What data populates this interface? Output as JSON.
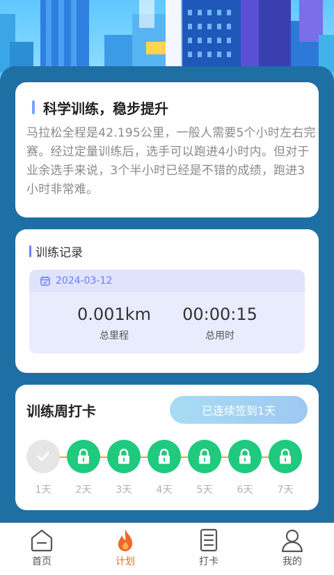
{
  "intro": {
    "title": "科学训练，稳步提升",
    "body": "马拉松全程是42.195公里，一般人需要5个小时左右完赛。经过定量训练后，选手可以跑进4小时内。但对于业余选手来说，3个半小时已经是不错的成绩，跑进3小时非常难。"
  },
  "record": {
    "title": "训练记录",
    "date": "2024-03-12",
    "distance": "0.001km",
    "distance_label": "总里程",
    "duration": "00:00:15",
    "duration_label": "总用时"
  },
  "checkin": {
    "title": "训练周打卡",
    "status": "已连续签到1天",
    "days": [
      {
        "label": "1天",
        "state": "done"
      },
      {
        "label": "2天",
        "state": "locked"
      },
      {
        "label": "3天",
        "state": "locked"
      },
      {
        "label": "4天",
        "state": "locked"
      },
      {
        "label": "5天",
        "state": "locked"
      },
      {
        "label": "6天",
        "state": "locked"
      },
      {
        "label": "7天",
        "state": "locked"
      }
    ]
  },
  "nav": {
    "items": [
      {
        "label": "首页",
        "icon": "home-icon"
      },
      {
        "label": "计划",
        "icon": "flame-icon",
        "active": true
      },
      {
        "label": "打卡",
        "icon": "checklist-icon"
      },
      {
        "label": "我的",
        "icon": "user-icon"
      }
    ]
  },
  "colors": {
    "panel": "#1e6fa3",
    "accent": "#6b7cff",
    "green": "#1fca7e",
    "active_nav": "#f0672c"
  }
}
